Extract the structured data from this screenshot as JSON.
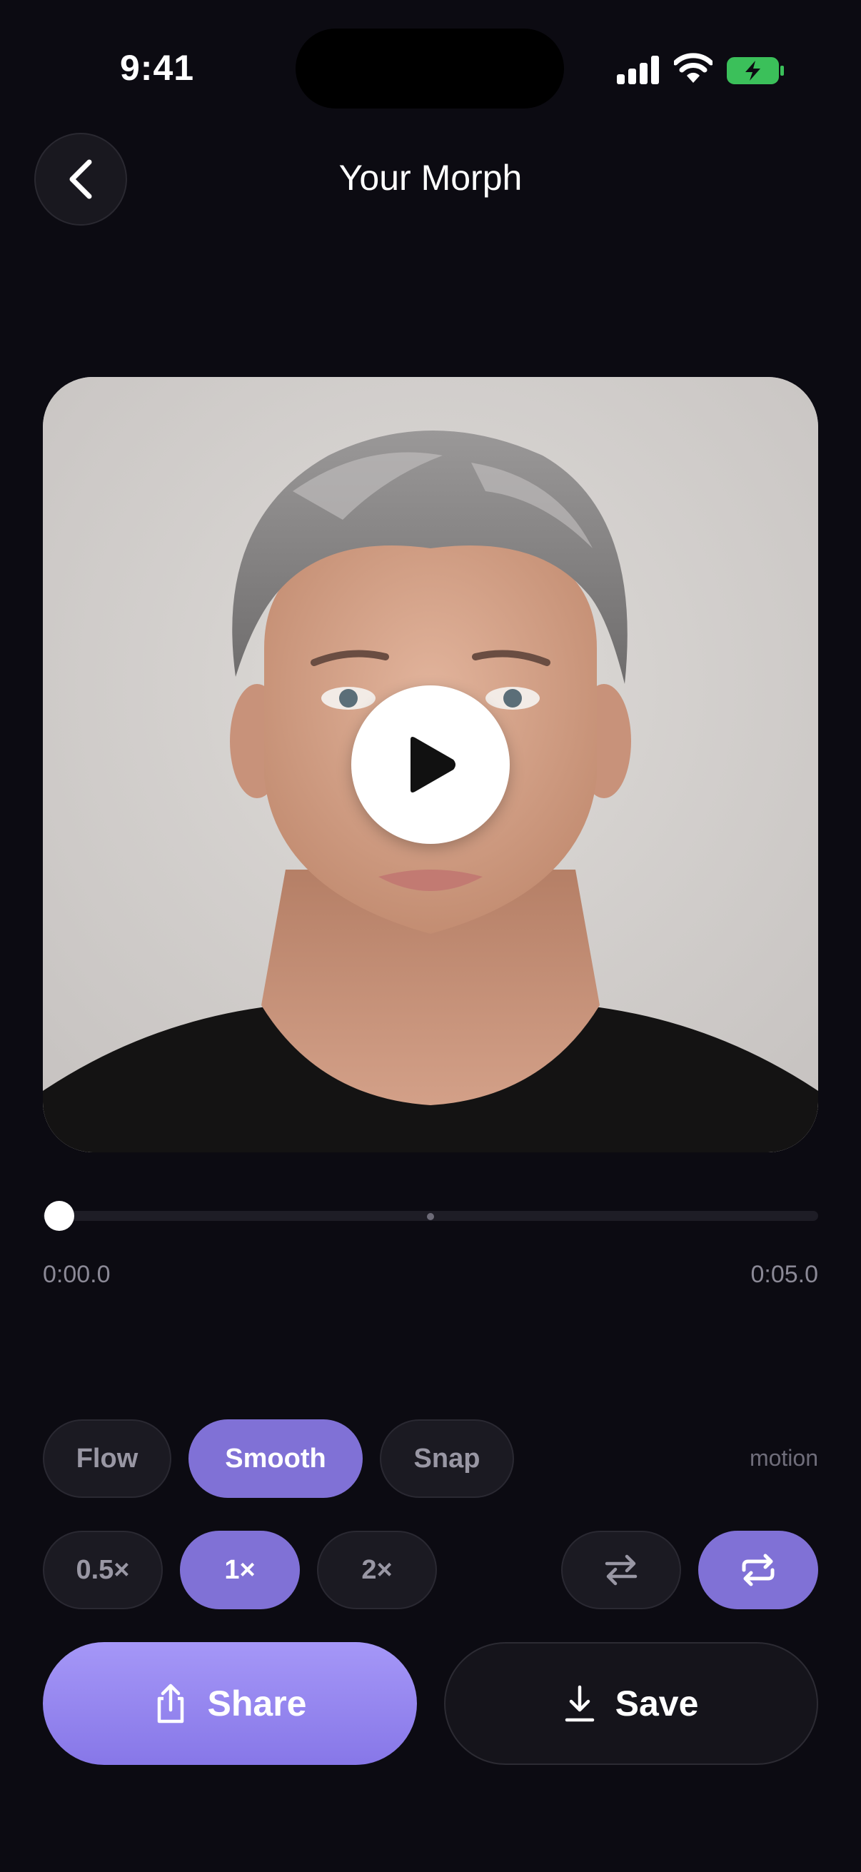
{
  "status": {
    "time": "9:41"
  },
  "header": {
    "title": "Your Morph",
    "back_icon": "chevron-left-icon"
  },
  "player": {
    "play_icon": "play-icon",
    "current_time": "0:00.0",
    "duration": "0:05.0",
    "progress": 0
  },
  "motion": {
    "label": "motion",
    "options": [
      "Flow",
      "Smooth",
      "Snap"
    ],
    "selected": "Smooth"
  },
  "speed": {
    "options": [
      "0.5×",
      "1×",
      "2×"
    ],
    "selected": "1×"
  },
  "toggles": {
    "swap_icon": "swap-arrows-icon",
    "loop_icon": "repeat-icon",
    "loop_active": true
  },
  "actions": {
    "share_label": "Share",
    "save_label": "Save",
    "share_icon": "share-icon",
    "save_icon": "download-icon"
  },
  "colors": {
    "accent": "#8071d6",
    "background": "#0c0b12"
  }
}
